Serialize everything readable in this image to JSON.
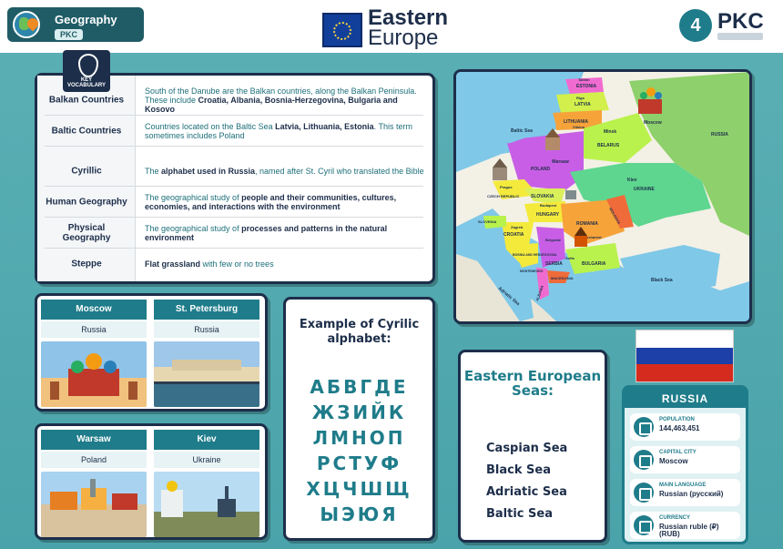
{
  "header": {
    "subject": "Geography",
    "stage": "PKC",
    "title_line1": "Eastern",
    "title_line2": "Europe",
    "logo_number": "4",
    "logo_text": "PKC"
  },
  "vocab": {
    "badge": "KEY VOCABULARY",
    "rows": [
      {
        "term": "Balkan Countries",
        "pre": "South of the Danube are the Balkan countries, along the Balkan Peninsula. These include ",
        "bold": "Croatia, Albania, Bosnia-Herzegovina, Bulgaria and Kosovo",
        "post": ""
      },
      {
        "term": "Baltic Countries",
        "pre": "Countries located on the Baltic Sea ",
        "bold": "Latvia, Lithuania, Estonia",
        "post": ". This term sometimes includes Poland"
      },
      {
        "term": "Cyrillic",
        "pre": "The ",
        "bold": "alphabet used in Russia",
        "post": ", named after St. Cyril who translated the Bible"
      },
      {
        "term": "Human Geography",
        "pre": "The geographical study of ",
        "bold": "people and their communities, cultures, economies, and interactions with the environment",
        "post": ""
      },
      {
        "term": "Physical Geography",
        "pre": "The geographical study of ",
        "bold": "processes and patterns in the natural environment",
        "post": ""
      },
      {
        "term": "Steppe",
        "pre": "",
        "bold": "Flat grassland",
        "post": " with few or no trees"
      }
    ]
  },
  "map": {
    "labels": [
      "ESTONIA",
      "LATVIA",
      "LITHUANIA",
      "BELARUS",
      "POLAND",
      "UKRAINE",
      "RUSSIA",
      "Moscow",
      "Minsk",
      "Warsaw",
      "Kiev",
      "Baltic Sea",
      "Black Sea",
      "Adriatic Sea",
      "CZECH REPUBLIC",
      "SLOVAKIA",
      "HUNGARY",
      "ROMANIA",
      "MOLDOVA",
      "SLOVENIA",
      "CROATIA",
      "BOSNIA AND HERZEGOVINA",
      "SERBIA",
      "BULGARIA",
      "MACEDONIA",
      "ALBANIA",
      "MONTENEGRO",
      "Prague",
      "Budapest",
      "Belgrade",
      "Bucharest",
      "Sofia",
      "Zagreb",
      "Riga",
      "Vilnius",
      "Tallinn"
    ]
  },
  "cities": [
    {
      "name": "Moscow",
      "country": "Russia"
    },
    {
      "name": "St. Petersburg",
      "country": "Russia"
    },
    {
      "name": "Warsaw",
      "country": "Poland"
    },
    {
      "name": "Kiev",
      "country": "Ukraine"
    }
  ],
  "cyrillic": {
    "heading": "Example of Cyrilic alphabet:",
    "rows": [
      "АБВГДЕ",
      "ЖЗИЙК",
      "ЛМНОП",
      "РСТУФ",
      "ХЦЧШЩ",
      "ЫЭЮЯ"
    ]
  },
  "seas": {
    "heading": "Eastern European Seas:",
    "items": [
      "Caspian Sea",
      "Black Sea",
      "Adriatic Sea",
      "Baltic Sea"
    ]
  },
  "russia": {
    "title": "RUSSIA",
    "flag_colors": [
      "#ffffff",
      "#1c3fa8",
      "#d52b1e"
    ],
    "facts": [
      {
        "label": "POPULATION",
        "value": "144,463,451",
        "icon": "people-icon"
      },
      {
        "label": "CAPITAL CITY",
        "value": "Moscow",
        "icon": "pin-icon"
      },
      {
        "label": "MAIN LANGUAGE",
        "value": "Russian (русский)",
        "icon": "speech-icon"
      },
      {
        "label": "CURRENCY",
        "value": "Russian ruble (₽) (RUB)",
        "icon": "coins-icon"
      }
    ]
  }
}
